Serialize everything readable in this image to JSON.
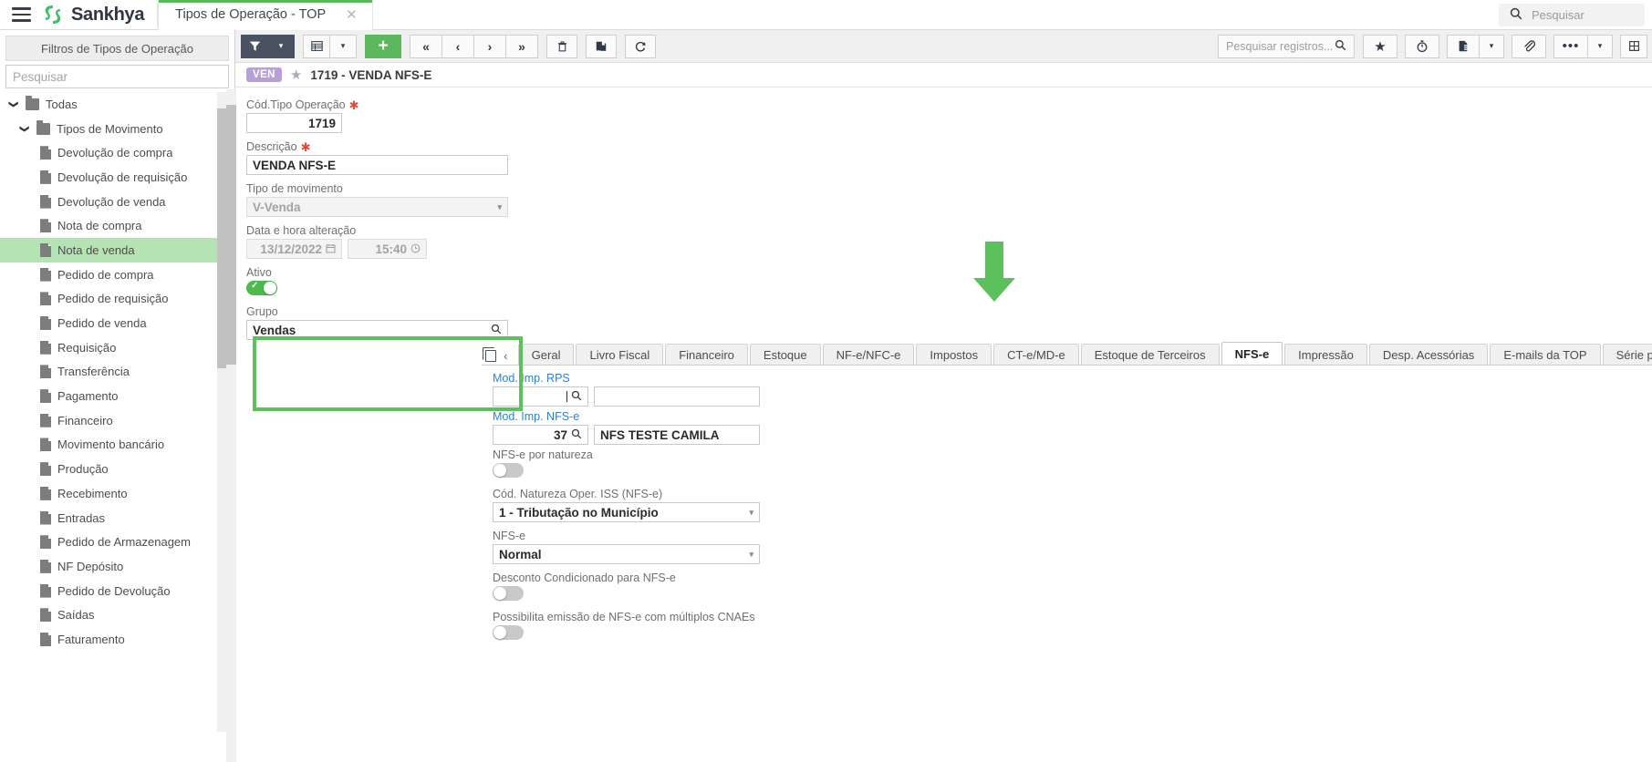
{
  "topbar": {
    "brand": "Sankhya",
    "tab_title": "Tipos de Operação - TOP",
    "tab_close": "✕",
    "search_placeholder": "Pesquisar",
    "search_icon": "search-icon"
  },
  "sidebar": {
    "filters_header": "Filtros de Tipos de Operação",
    "search_placeholder": "Pesquisar",
    "tree": [
      {
        "label": "Todas",
        "level": 1,
        "type": "folder-root",
        "expanded": true,
        "selected": false
      },
      {
        "label": "Tipos de Movimento",
        "level": 2,
        "type": "folder",
        "expanded": true,
        "selected": false
      },
      {
        "label": "Devolução de compra",
        "level": 3,
        "type": "doc",
        "selected": false
      },
      {
        "label": "Devolução de requisição",
        "level": 3,
        "type": "doc",
        "selected": false
      },
      {
        "label": "Devolução de venda",
        "level": 3,
        "type": "doc",
        "selected": false
      },
      {
        "label": "Nota de compra",
        "level": 3,
        "type": "doc",
        "selected": false
      },
      {
        "label": "Nota de venda",
        "level": 3,
        "type": "doc",
        "selected": true
      },
      {
        "label": "Pedido de compra",
        "level": 3,
        "type": "doc",
        "selected": false
      },
      {
        "label": "Pedido de requisição",
        "level": 3,
        "type": "doc",
        "selected": false
      },
      {
        "label": "Pedido de venda",
        "level": 3,
        "type": "doc",
        "selected": false
      },
      {
        "label": "Requisição",
        "level": 3,
        "type": "doc",
        "selected": false
      },
      {
        "label": "Transferência",
        "level": 3,
        "type": "doc",
        "selected": false
      },
      {
        "label": "Pagamento",
        "level": 3,
        "type": "doc",
        "selected": false
      },
      {
        "label": "Financeiro",
        "level": 3,
        "type": "doc",
        "selected": false
      },
      {
        "label": "Movimento bancário",
        "level": 3,
        "type": "doc",
        "selected": false
      },
      {
        "label": "Produção",
        "level": 3,
        "type": "doc",
        "selected": false
      },
      {
        "label": "Recebimento",
        "level": 3,
        "type": "doc",
        "selected": false
      },
      {
        "label": "Entradas",
        "level": 3,
        "type": "doc",
        "selected": false
      },
      {
        "label": "Pedido de Armazenagem",
        "level": 3,
        "type": "doc",
        "selected": false
      },
      {
        "label": "NF Depósito",
        "level": 3,
        "type": "doc",
        "selected": false
      },
      {
        "label": "Pedido de Devolução",
        "level": 3,
        "type": "doc",
        "selected": false
      },
      {
        "label": "Saídas",
        "level": 3,
        "type": "doc",
        "selected": false
      },
      {
        "label": "Faturamento",
        "level": 3,
        "type": "doc",
        "selected": false
      }
    ]
  },
  "toolbar": {
    "filter_icon": "filter-icon",
    "filter_caret": "▾",
    "grid_icon": "grid-icon",
    "grid_caret": "▾",
    "add_label": "+",
    "first_icon": "«",
    "prev_icon": "‹",
    "next_icon": "›",
    "last_icon": "»",
    "delete_icon": "trash-icon",
    "duplicate_icon": "copy-records-icon",
    "refresh_icon": "refresh-icon",
    "search_placeholder": "Pesquisar registros...",
    "search_icon": "search-icon",
    "favorite_icon": "★",
    "timer_icon": "stopwatch-icon",
    "report_icon": "report-icon",
    "report_caret": "▾",
    "attach_icon": "paperclip-icon",
    "more_icon": "•••",
    "more_caret": "▾",
    "grid_toggle_icon": "grid-toggle-icon"
  },
  "record": {
    "badge": "VEN",
    "star_icon": "star-icon",
    "title": "1719 - VENDA NFS-E"
  },
  "form": {
    "cod_tipo_operacao": {
      "label": "Cód.Tipo Operação",
      "required": "✱",
      "value": "1719"
    },
    "descricao": {
      "label": "Descrição",
      "required": "✱",
      "value": "VENDA NFS-E"
    },
    "tipo_movimento": {
      "label": "Tipo de movimento",
      "value": "V-Venda",
      "caret": "▾"
    },
    "data_hora": {
      "label": "Data e hora alteração",
      "date_value": "13/12/2022",
      "date_icon": "calendar-icon",
      "time_value": "15:40",
      "time_icon": "clock-icon"
    },
    "ativo": {
      "label": "Ativo",
      "state": "on"
    },
    "grupo": {
      "label": "Grupo",
      "value": "Vendas",
      "icon": "search-icon"
    }
  },
  "tabs": {
    "copy_icon": "copy-tabs-icon",
    "prev_icon": "‹",
    "items": [
      {
        "label": "Geral",
        "active": false
      },
      {
        "label": "Livro Fiscal",
        "active": false
      },
      {
        "label": "Financeiro",
        "active": false
      },
      {
        "label": "Estoque",
        "active": false
      },
      {
        "label": "NF-e/NFC-e",
        "active": false
      },
      {
        "label": "Impostos",
        "active": false
      },
      {
        "label": "CT-e/MD-e",
        "active": false
      },
      {
        "label": "Estoque de Terceiros",
        "active": false
      },
      {
        "label": "NFS-e",
        "active": true
      },
      {
        "label": "Impressão",
        "active": false
      },
      {
        "label": "Desp. Acessórias",
        "active": false
      },
      {
        "label": "E-mails da TOP",
        "active": false
      },
      {
        "label": "Série por empresa",
        "active": false
      }
    ]
  },
  "nfse_panel": {
    "mod_imp_rps": {
      "label": "Mod. Imp. RPS",
      "code_value": "",
      "icon": "search-icon",
      "desc_value": ""
    },
    "mod_imp_nfse": {
      "label": "Mod. Imp. NFS-e",
      "code_value": "37",
      "icon": "search-icon",
      "desc_value": "NFS TESTE CAMILA"
    },
    "nfse_por_natureza": {
      "label": "NFS-e por natureza",
      "state": "off"
    },
    "cod_natureza": {
      "label": "Cód. Natureza Oper. ISS (NFS-e)",
      "value": "1 - Tributação no Município",
      "caret": "▾"
    },
    "nfse": {
      "label": "NFS-e",
      "value": "Normal",
      "caret": "▾"
    },
    "desconto_condicionado": {
      "label": "Desconto Condicionado para NFS-e",
      "state": "off"
    },
    "multiplos_cnaes": {
      "label": "Possibilita emissão de NFS-e com múltiplos CNAEs",
      "state": "off"
    }
  },
  "annotations": {
    "highlight_color": "#5cc15c",
    "arrow_target": "NFS-e",
    "box_target": "Mod. Imp. RPS / Mod. Imp. NFS-e"
  }
}
